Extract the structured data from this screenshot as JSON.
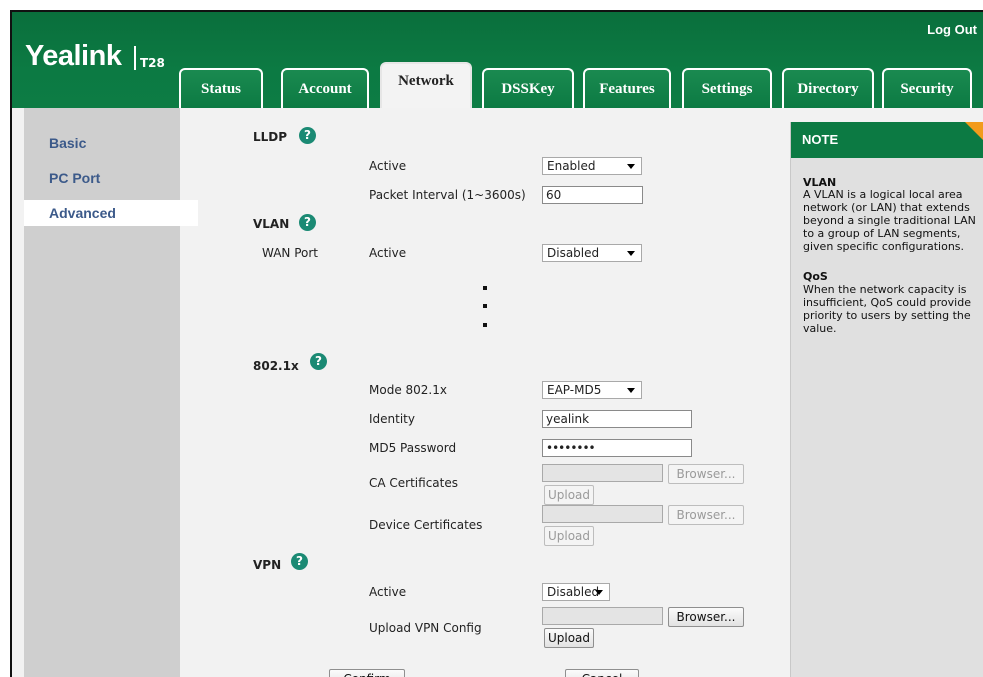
{
  "header": {
    "logo": "Yealink",
    "model": "T28",
    "logout": "Log Out",
    "tabs": [
      {
        "label": "Status"
      },
      {
        "label": "Account"
      },
      {
        "label": "Network",
        "active": true
      },
      {
        "label": "DSSKey"
      },
      {
        "label": "Features"
      },
      {
        "label": "Settings"
      },
      {
        "label": "Directory"
      },
      {
        "label": "Security"
      }
    ]
  },
  "sidebar": {
    "items": [
      {
        "label": "Basic"
      },
      {
        "label": "PC Port"
      },
      {
        "label": "Advanced",
        "active": true
      }
    ]
  },
  "lldp": {
    "title": "LLDP",
    "active_label": "Active",
    "active_value": "Enabled",
    "interval_label": "Packet Interval (1~3600s)",
    "interval_value": "60"
  },
  "vlan": {
    "title": "VLAN",
    "wan_port_label": "WAN Port",
    "active_label": "Active",
    "active_value": "Disabled"
  },
  "dot1x": {
    "title": "802.1x",
    "mode_label": "Mode 802.1x",
    "mode_value": "EAP-MD5",
    "identity_label": "Identity",
    "identity_value": "yealink",
    "password_label": "MD5 Password",
    "password_value": "••••••••",
    "ca_label": "CA Certificates",
    "device_label": "Device Certificates",
    "browse_label": "Browser...",
    "upload_label": "Upload"
  },
  "vpn": {
    "title": "VPN",
    "active_label": "Active",
    "active_value": "Disabled",
    "config_label": "Upload VPN Config",
    "browse_label": "Browser...",
    "upload_label": "Upload"
  },
  "footer": {
    "confirm": "Confirm",
    "cancel": "Cancel"
  },
  "note": {
    "title": "NOTE",
    "help_icon_text": "?",
    "vlan_title": "VLAN",
    "vlan_text": "A VLAN is a logical local area network (or LAN) that extends beyond a single traditional LAN to a group of LAN segments, given specific configurations.",
    "qos_title": "QoS",
    "qos_text": "When the network capacity is insufficient, QoS could provide priority to users by setting the value."
  },
  "colors": {
    "header_green": "#0c7a43",
    "help_teal": "#1b8a74",
    "note_corner": "#f29b1c",
    "sidebar_link": "#3c5a8a"
  }
}
